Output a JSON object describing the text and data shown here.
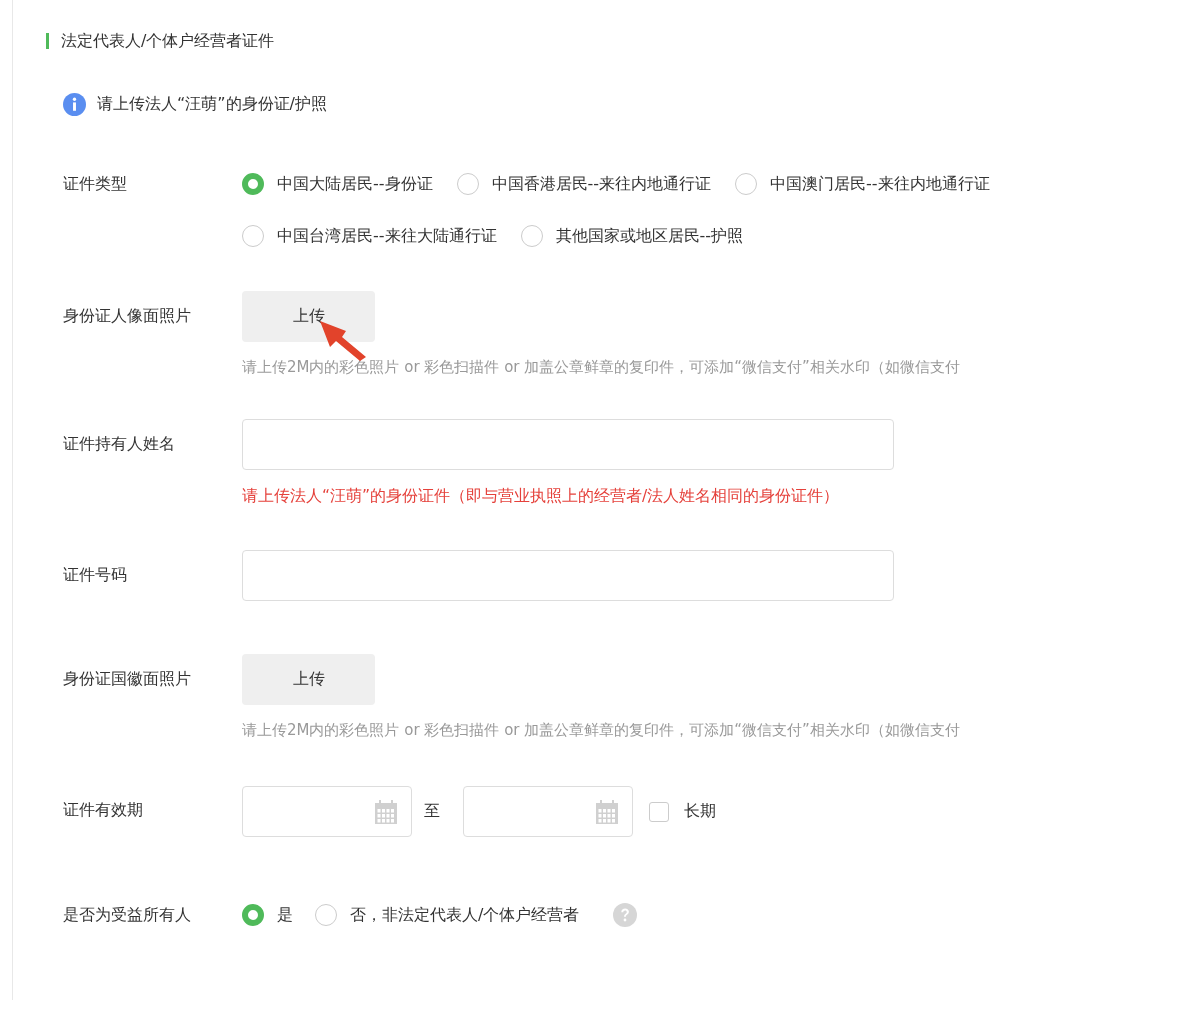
{
  "section_title": "法定代表人/个体户经营者证件",
  "notice": "请上传法人“汪萌”的身份证/护照",
  "id_type": {
    "label": "证件类型",
    "options": [
      {
        "label": "中国大陆居民--身份证",
        "selected": true
      },
      {
        "label": "中国香港居民--来往内地通行证",
        "selected": false
      },
      {
        "label": "中国澳门居民--来往内地通行证",
        "selected": false
      },
      {
        "label": "中国台湾居民--来往大陆通行证",
        "selected": false
      },
      {
        "label": "其他国家或地区居民--护照",
        "selected": false
      }
    ]
  },
  "front_photo": {
    "label": "身份证人像面照片",
    "button": "上传",
    "hint": "请上传2M内的彩色照片 or 彩色扫描件 or 加盖公章鲜章的复印件，可添加“微信支付”相关水印（如微信支付"
  },
  "holder_name": {
    "label": "证件持有人姓名",
    "error": "请上传法人“汪萌”的身份证件（即与营业执照上的经营者/法人姓名相同的身份证件）"
  },
  "id_number": {
    "label": "证件号码"
  },
  "back_photo": {
    "label": "身份证国徽面照片",
    "button": "上传",
    "hint": "请上传2M内的彩色照片 or 彩色扫描件 or 加盖公章鲜章的复印件，可添加“微信支付”相关水印（如微信支付"
  },
  "validity": {
    "label": "证件有效期",
    "separator": "至",
    "long_term": {
      "label": "长期",
      "checked": false
    }
  },
  "beneficiary": {
    "label": "是否为受益所有人",
    "options": [
      {
        "label": "是",
        "selected": true
      },
      {
        "label": "否，非法定代表人/个体户经营者",
        "selected": false
      }
    ]
  }
}
